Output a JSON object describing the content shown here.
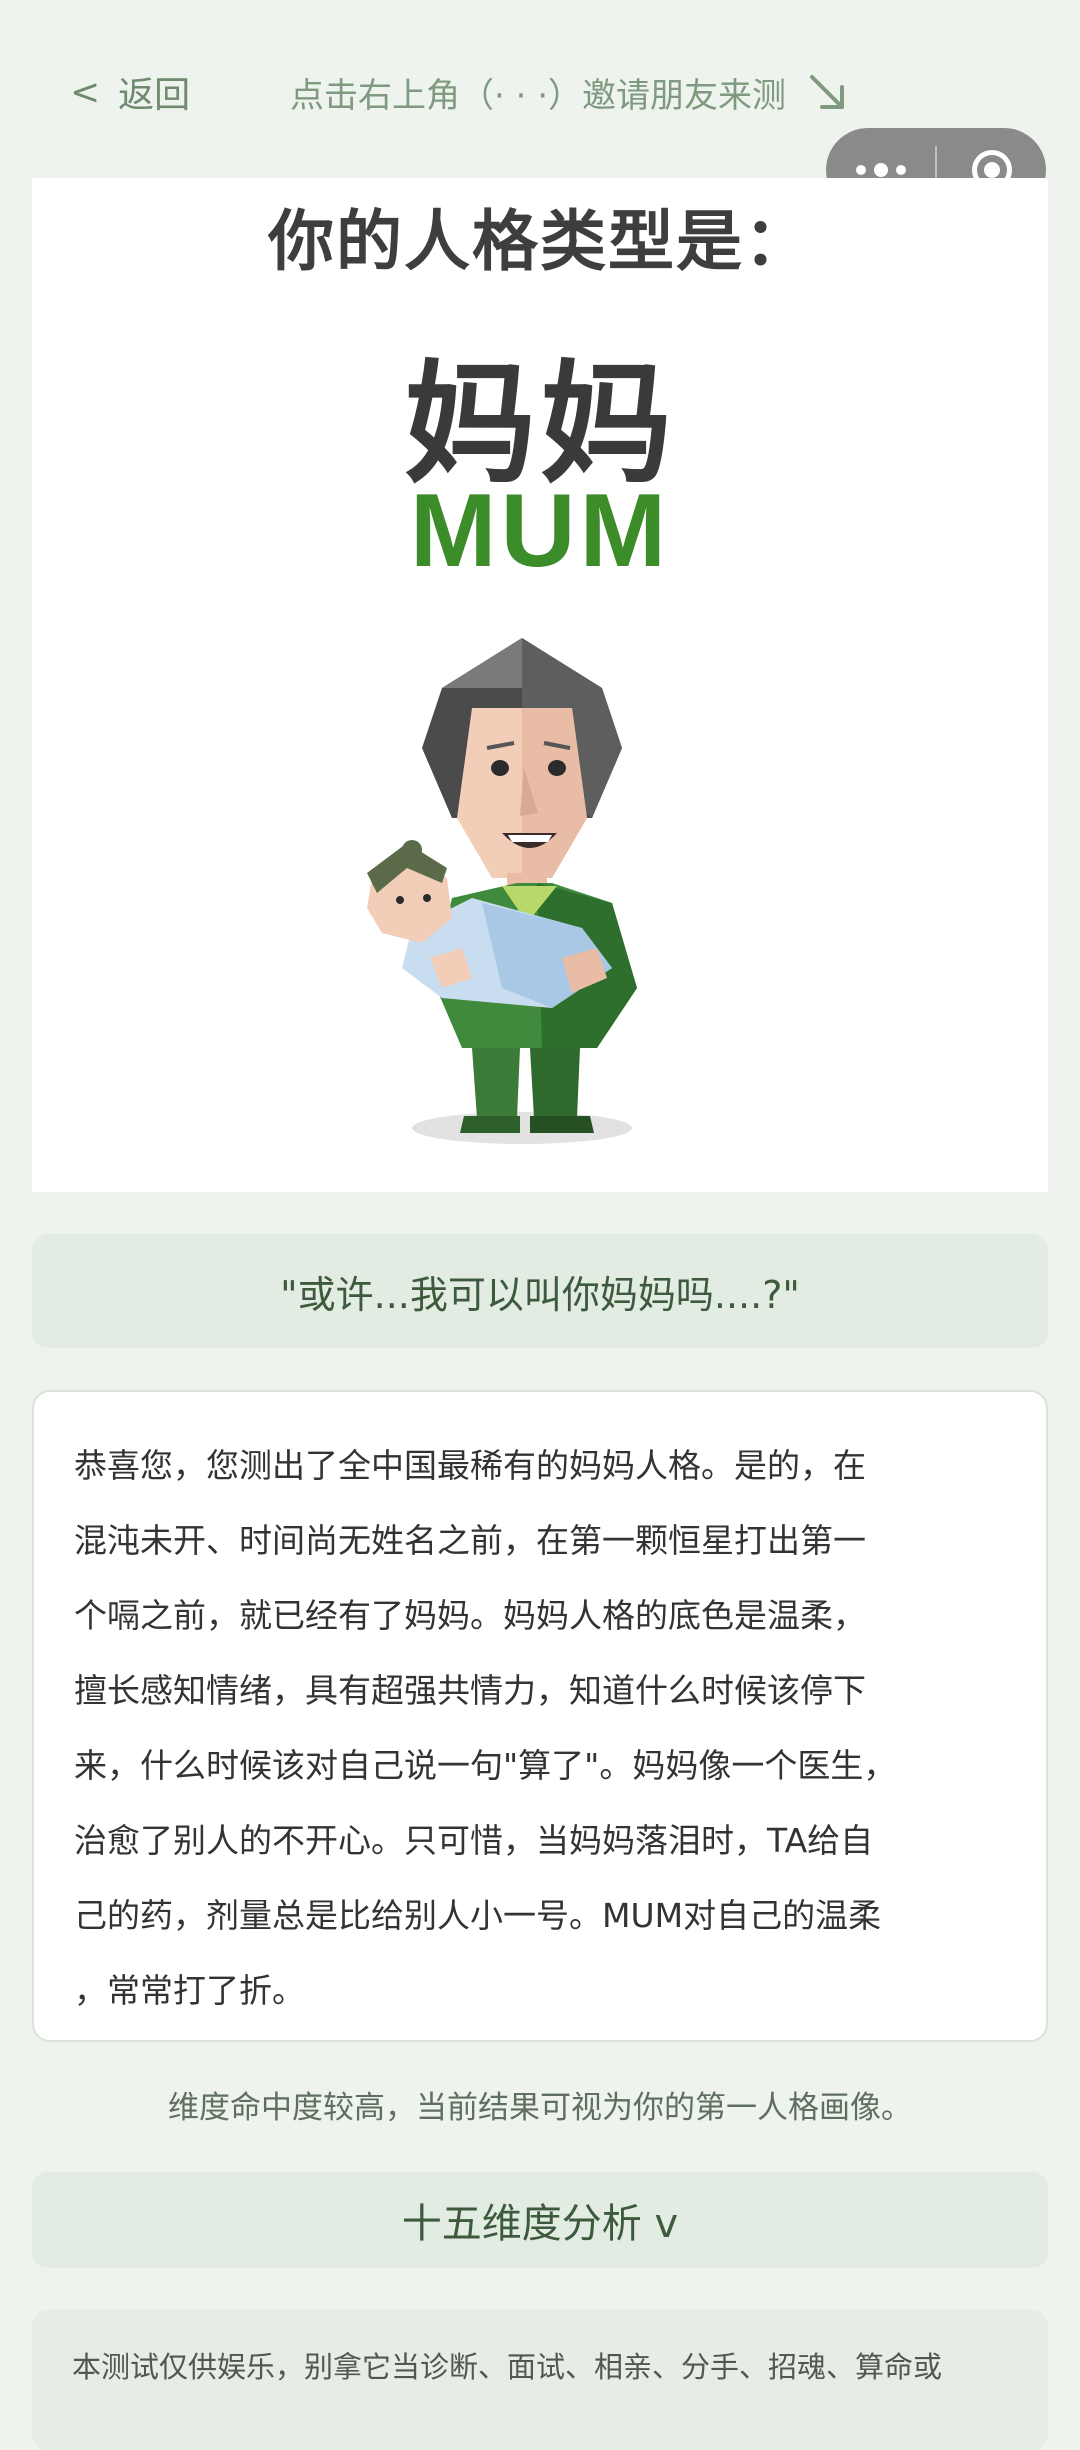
{
  "header": {
    "back_chevron": "<",
    "back_label": "返回",
    "invite_text": "点击右上角（· · ·）邀请朋友来测",
    "arrow_icon": "arrow-down-right-icon"
  },
  "capsule": {
    "menu_icon": "more-dots-icon",
    "close_icon": "target-close-icon"
  },
  "poster": {
    "title": "你的人格类型是：",
    "type_cn": "妈妈",
    "type_en": "MUM",
    "accent_color": "#3c8c2a"
  },
  "quote": "\"或许...我可以叫你妈妈吗....?\"",
  "description": "恭喜您，您测出了全中国最稀有的妈妈人格。是的，在\n混沌未开、时间尚无姓名之前，在第一颗恒星打出第一\n个嗝之前，就已经有了妈妈。妈妈人格的底色是温柔，\n擅长感知情绪，具有超强共情力，知道什么时候该停下\n来，什么时候该对自己说一句\"算了\"。妈妈像一个医生，\n治愈了别人的不开心。只可惜，当妈妈落泪时，TA给自\n己的药，剂量总是比给别人小一号。MUM对自己的温柔\n，常常打了折。",
  "note": "维度命中度较高，当前结果可视为你的第一人格画像。",
  "analysis_button": "十五维度分析 v",
  "disclaimer": "本测试仅供娱乐，别拿它当诊断、面试、相亲、分手、招魂、算命或"
}
